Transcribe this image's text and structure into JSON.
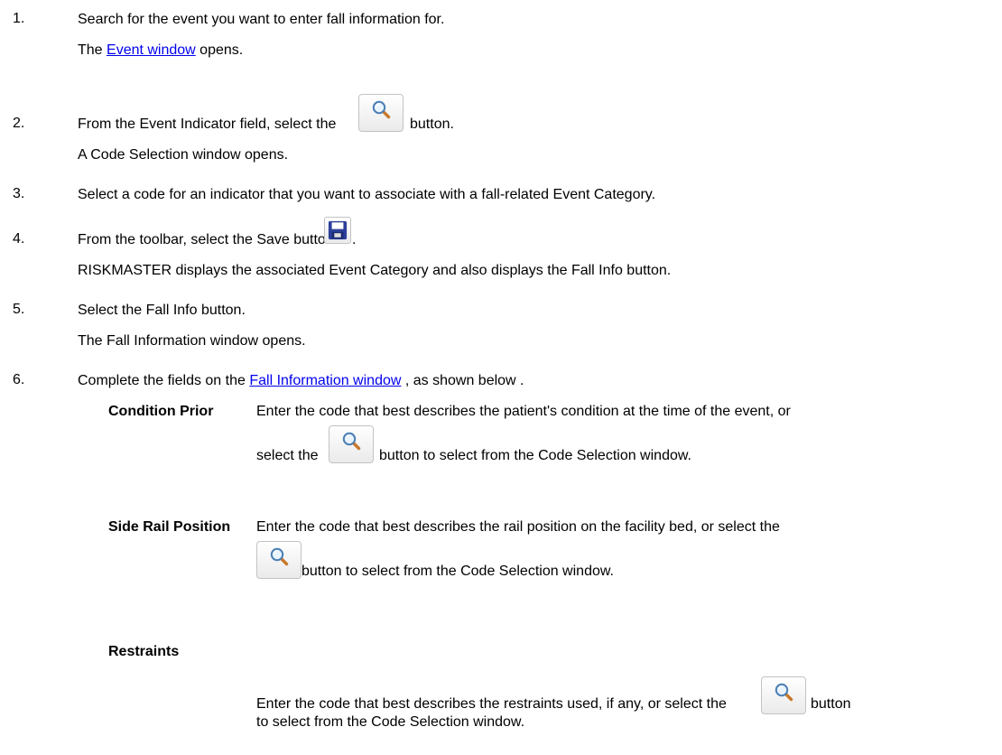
{
  "steps": [
    {
      "num": "1.",
      "text": "Search for the event you want to enter fall information for.",
      "result_pre": "The ",
      "result_link": "Event window",
      "result_post": " opens."
    },
    {
      "num": "2.",
      "text_pre": "From the Event Indicator field, select the ",
      "text_post": " button.",
      "result": "A Code Selection window opens."
    },
    {
      "num": "3.",
      "text": "Select a code for an indicator that you want to associate with a fall-related Event Category."
    },
    {
      "num": "4.",
      "text_pre": "From the toolbar, select the Save button ",
      "text_post": ".",
      "result": "RISKMASTER displays the associated Event Category and also displays the Fall Info button."
    },
    {
      "num": "5.",
      "text": "Select the Fall Info button.",
      "result": "The Fall Information window opens."
    },
    {
      "num": "6.",
      "text_pre": "Complete the fields on the ",
      "link": "Fall Information window",
      "text_post": " , as shown below ."
    }
  ],
  "fields": [
    {
      "label": "Condition Prior",
      "desc_line1": "Enter the code that best describes the patient's condition at the time of the event, or",
      "desc_pre": "select the ",
      "desc_post": " button to select from the Code Selection window."
    },
    {
      "label": "Side Rail Position",
      "desc_line1": "Enter the code that best describes the rail position on the facility bed, or select the",
      "desc_post": " button to select from the Code Selection window."
    },
    {
      "label": "Restraints",
      "desc_pre": "Enter the code that best describes the restraints used, if any, or select the ",
      "desc_post": " button",
      "desc_line2": "to select from the Code Selection window."
    }
  ],
  "colors": {
    "link": "#0000ee",
    "floppy": "#2b3f9a"
  },
  "icons": {
    "search": "magnifier-icon",
    "save": "floppy-disk-icon"
  }
}
